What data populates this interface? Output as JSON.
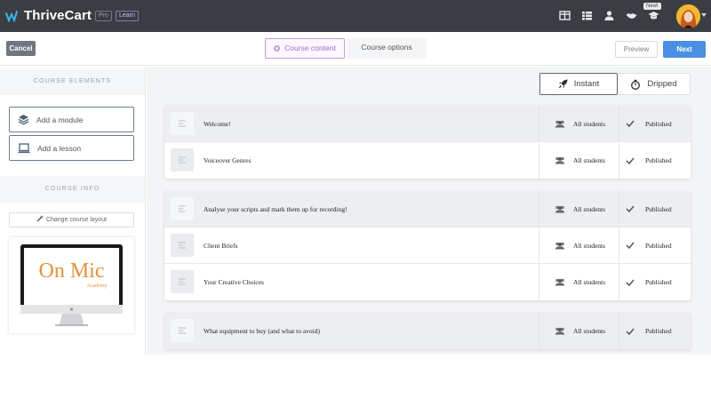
{
  "app": {
    "brand": "ThriveCart",
    "badge_pro": "Pro",
    "badge_learn": "Learn",
    "new_badge": "New!",
    "nav_icons": [
      "layout-icon",
      "list-icon",
      "user-icon",
      "handshake-icon",
      "graduation-cap-icon"
    ]
  },
  "toolbar": {
    "cancel_label": "Cancel",
    "tab_content_label": "Course content",
    "tab_options_label": "Course options",
    "preview_label": "Preview",
    "next_label": "Next"
  },
  "sidebar": {
    "elements_heading": "COURSE ELEMENTS",
    "add_module_label": "Add a module",
    "add_lesson_label": "Add a lesson",
    "info_heading": "COURSE INFO",
    "change_layout_label": "Change course layout",
    "thumbnail_text": "On Mic",
    "thumbnail_subtext": "Academy"
  },
  "delivery": {
    "instant_label": "Instant",
    "dripped_label": "Dripped"
  },
  "modules": [
    {
      "rows": [
        {
          "title": "Welcome!",
          "access": "All students",
          "status": "Published",
          "is_module": true
        },
        {
          "title": "Voiceover Genres",
          "access": "All students",
          "status": "Published",
          "is_module": false
        }
      ]
    },
    {
      "rows": [
        {
          "title": "Analyse your scripts and mark them up for recording!",
          "access": "All students",
          "status": "Published",
          "is_module": true
        },
        {
          "title": "Client Briefs",
          "access": "All students",
          "status": "Published",
          "is_module": false
        },
        {
          "title": "Your Creative Choices",
          "access": "All students",
          "status": "Published",
          "is_module": false
        }
      ]
    },
    {
      "rows": [
        {
          "title": "What equipment to buy (and what to avoid)",
          "access": "All students",
          "status": "Published",
          "is_module": true
        }
      ]
    }
  ],
  "colors": {
    "topbar": "#3a3d42",
    "accent_purple": "#c79be2",
    "next_blue": "#4a90e2",
    "thumbnail_orange": "#e2923a"
  }
}
